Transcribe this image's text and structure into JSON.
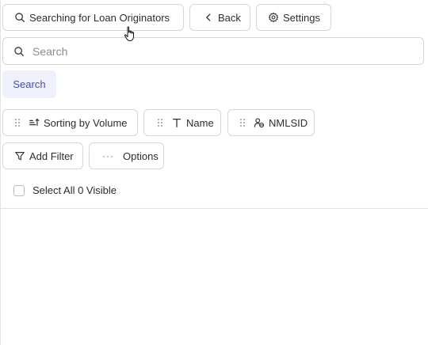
{
  "toolbar": {
    "search_loan_originators_label": "Searching for Loan Originators",
    "back_label": "Back",
    "settings_label": "Settings"
  },
  "search": {
    "placeholder": "Search",
    "value": "",
    "submit_label": "Search"
  },
  "columns": [
    {
      "label": "Sorting by Volume",
      "icon": "sort-ascending-icon"
    },
    {
      "label": "Name",
      "icon": "text-type-icon"
    },
    {
      "label": "NMLSID",
      "icon": "user-id-icon"
    }
  ],
  "actions": {
    "add_filter_label": "Add Filter",
    "options_label": "Options"
  },
  "selection": {
    "select_all_label": "Select All 0 Visible",
    "checked": false
  },
  "colors": {
    "accent_bg": "#eef0fb",
    "accent_text": "#4a4f9c",
    "border": "#d6d6d6"
  }
}
